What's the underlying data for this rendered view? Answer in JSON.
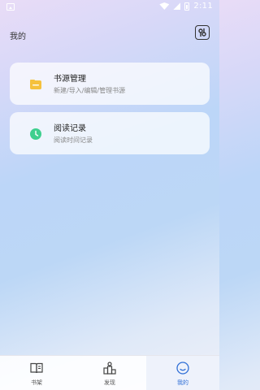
{
  "status_bar": {
    "time": "2:11"
  },
  "header": {
    "title": "我的",
    "settings_icon": "settings-icon"
  },
  "cards": [
    {
      "title": "书源管理",
      "subtitle": "新建/导入/编辑/管理书源",
      "icon": "folder-icon",
      "icon_color": "#f5c13d"
    },
    {
      "title": "阅读记录",
      "subtitle": "阅读时间记录",
      "icon": "clock-icon",
      "icon_color": "#3ecf8e"
    }
  ],
  "nav": {
    "items": [
      {
        "label": "书架",
        "icon": "book-icon",
        "active": false
      },
      {
        "label": "发现",
        "icon": "discover-icon",
        "active": false
      },
      {
        "label": "我的",
        "icon": "smile-icon",
        "active": true
      }
    ],
    "active_color": "#2f6fd6"
  }
}
